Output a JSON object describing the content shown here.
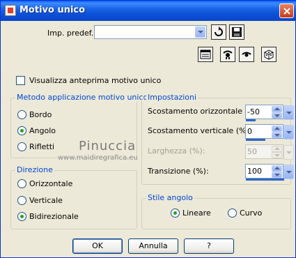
{
  "window": {
    "title": "Motivo unico"
  },
  "preset": {
    "label": "Imp. predef.:",
    "value": ""
  },
  "preview": {
    "checkbox_label": "Visualizza anteprima motivo unico",
    "checked": false
  },
  "method_group": {
    "title": "Metodo applicazione motivo unico",
    "options": [
      "Bordo",
      "Angolo",
      "Rifletti"
    ],
    "selected": "Angolo"
  },
  "direction_group": {
    "title": "Direzione",
    "options": [
      "Orizzontale",
      "Verticale",
      "Bidirezionale"
    ],
    "selected": "Bidirezionale"
  },
  "settings_group": {
    "title": "Impostazioni",
    "fields": [
      {
        "label": "Scostamento orizzontale (%):",
        "value": "-50",
        "enabled": true
      },
      {
        "label": "Scostamento verticale (%):",
        "value": "0",
        "enabled": true
      },
      {
        "label": "Larghezza (%):",
        "value": "50",
        "enabled": false
      },
      {
        "label": "Transizione (%):",
        "value": "100",
        "enabled": true
      }
    ]
  },
  "corner_group": {
    "title": "Stile angolo",
    "options": [
      "Lineare",
      "Curvo"
    ],
    "selected": "Lineare"
  },
  "watermark": {
    "title": "Pinuccia",
    "url": "www.maidiregrafica.eu"
  },
  "buttons": {
    "ok": "OK",
    "cancel": "Annulla",
    "help": "?"
  },
  "icons": {
    "title": "app-icon",
    "close": "close-icon",
    "reset": "reset-icon",
    "save": "save-icon",
    "preview": "preview-window-icon",
    "eye1": "eye-icon",
    "eye2": "eye-closed-icon",
    "random": "dice-icon"
  }
}
